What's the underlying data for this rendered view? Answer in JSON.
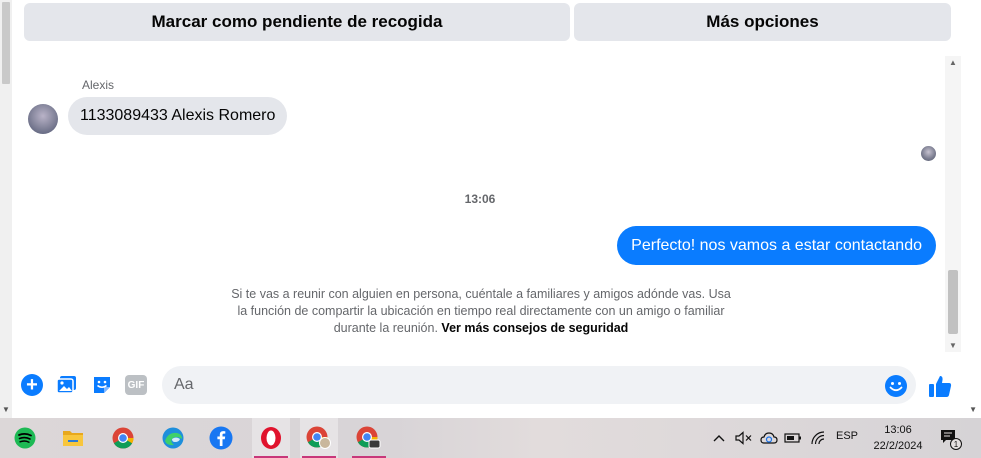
{
  "top_actions": {
    "pickup_label": "Marcar como pendiente de recogida",
    "more_label": "Más opciones"
  },
  "conversation": {
    "incoming": {
      "sender": "Alexis",
      "text": "1133089433 Alexis Romero"
    },
    "timestamp": "13:06",
    "outgoing": {
      "text": "Perfecto! nos vamos a estar contactando"
    },
    "safety_notice": {
      "text": "Si te vas a reunir con alguien en persona, cuéntale a familiares y amigos adónde vas. Usa la función de compartir la ubicación en tiempo real directamente con un amigo o familiar durante la reunión.",
      "link": "Ver más consejos de seguridad"
    }
  },
  "composer": {
    "placeholder": "Aa",
    "icons": [
      "plus-icon",
      "photo-icon",
      "sticker-icon",
      "gif-icon",
      "emoji-icon",
      "like-icon"
    ],
    "gif_label": "GIF"
  },
  "taskbar": {
    "apps": [
      "spotify-icon",
      "file-explorer-icon",
      "chrome-icon",
      "edge-icon",
      "facebook-icon",
      "opera-icon",
      "chrome-profile-icon",
      "chrome-profile-2-icon"
    ],
    "language": "ESP",
    "time": "13:06",
    "date": "22/2/2024",
    "notification_count": "1"
  },
  "colors": {
    "accent": "#0a7cff",
    "bubble_in": "#e4e6eb",
    "input_bg": "#f0f2f5",
    "taskbar_indicator": "#c8377a"
  }
}
